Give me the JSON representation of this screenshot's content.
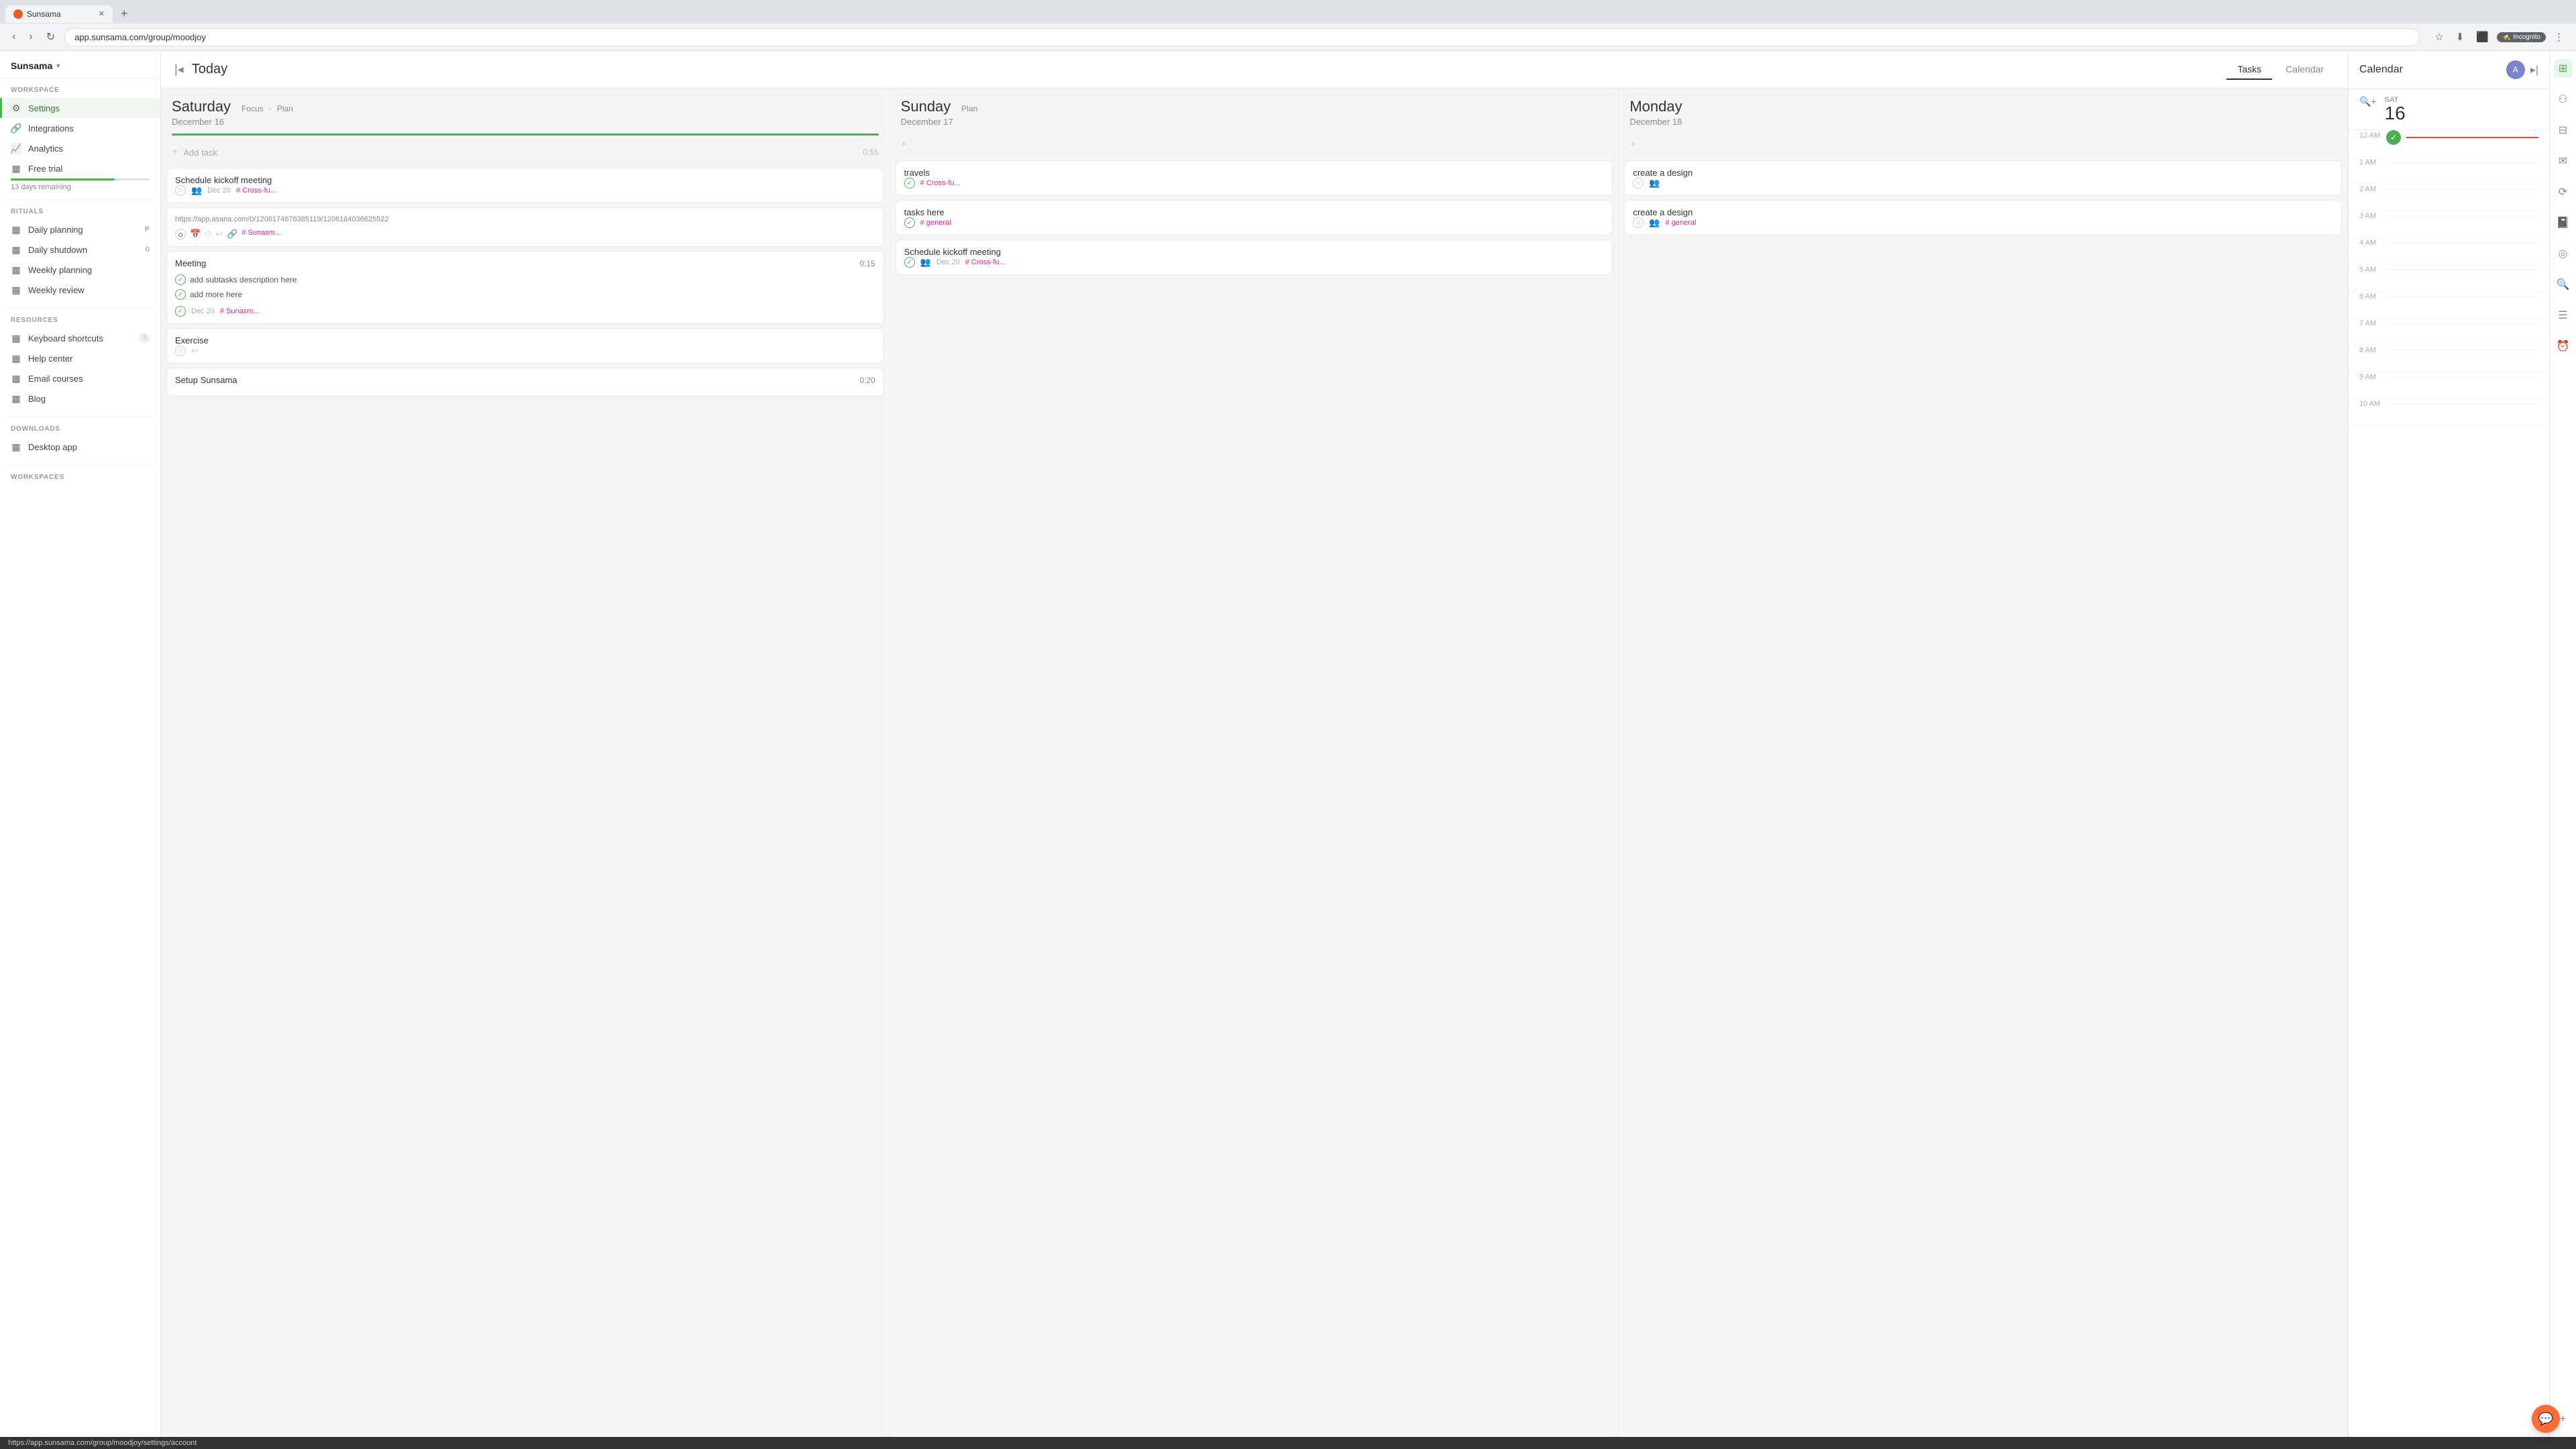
{
  "browser": {
    "tab_title": "Sunsama",
    "tab_url": "app.sunsama.com/group/moodjoy",
    "incognito_label": "Incognito"
  },
  "sidebar": {
    "app_name": "Sunsama",
    "workspace_label": "WORKSPACE",
    "settings_label": "Settings",
    "integrations_label": "Integrations",
    "analytics_label": "Analytics",
    "free_trial_label": "Free trial",
    "free_trial_days": "13 days remaining",
    "free_trial_progress": 75,
    "rituals_label": "RITUALS",
    "daily_planning_label": "Daily planning",
    "daily_planning_badge": "P",
    "daily_shutdown_label": "Daily shutdown",
    "daily_shutdown_badge": "0",
    "weekly_planning_label": "Weekly planning",
    "weekly_review_label": "Weekly review",
    "resources_label": "RESOURCES",
    "keyboard_shortcuts_label": "Keyboard shortcuts",
    "help_center_label": "Help center",
    "email_courses_label": "Email courses",
    "blog_label": "Blog",
    "downloads_label": "DOWNLOADS",
    "desktop_app_label": "Desktop app",
    "workspaces_label": "WORKSPACES"
  },
  "topbar": {
    "title": "Today",
    "tasks_tab": "Tasks",
    "calendar_tab": "Calendar"
  },
  "saturday": {
    "day_name": "Saturday",
    "date": "December 16",
    "action_focus": "Focus",
    "action_plan": "Plan",
    "add_task_label": "Add task",
    "add_task_time": "0:55",
    "tasks": [
      {
        "title": "Schedule kickoff meeting",
        "date": "Dec 20",
        "tag": "Cross-fu...",
        "has_people": true,
        "has_check": true
      },
      {
        "title": "https://app.asana.com/0/1206174676385119/1206184036625522",
        "is_url": true,
        "tag": "Sunasm...",
        "has_actions": true
      },
      {
        "title": "Meeting",
        "time": "0:15",
        "date": "Dec 20",
        "tag": "Sunasm...",
        "subtasks": [
          "add subtasks description here",
          "add more here"
        ]
      },
      {
        "title": "Exercise",
        "has_repeat": true
      },
      {
        "title": "Setup Sunsama",
        "time": "0:20"
      }
    ]
  },
  "sunday": {
    "day_name": "Sunday",
    "date": "December 17",
    "action_plan": "Plan",
    "tasks": [
      {
        "title": "travels",
        "tag": "Cross-fu...",
        "has_check": true,
        "done": true
      },
      {
        "title": "tasks here",
        "tag": "general",
        "has_check": true,
        "done": true
      },
      {
        "title": "Schedule kickoff meeting",
        "date": "Dec 20",
        "tag": "Cross-fu...",
        "done": true
      }
    ]
  },
  "monday": {
    "day_name": "Monday",
    "date": "December 18",
    "tasks": [
      {
        "title": "create a design",
        "has_people": true,
        "has_check": true
      },
      {
        "title": "create a design",
        "tag": "general",
        "has_people": true,
        "has_check": true
      }
    ]
  },
  "calendar_panel": {
    "title": "Calendar",
    "day_of_week": "SAT",
    "day_num": "16",
    "time_slots": [
      "12 AM",
      "1 AM",
      "2 AM",
      "3 AM",
      "4 AM",
      "5 AM",
      "6 AM",
      "7 AM",
      "8 AM",
      "9 AM",
      "10 AM"
    ]
  },
  "status_bar": {
    "url": "https://app.sunsama.com/group/moodjoy/settings/account"
  }
}
